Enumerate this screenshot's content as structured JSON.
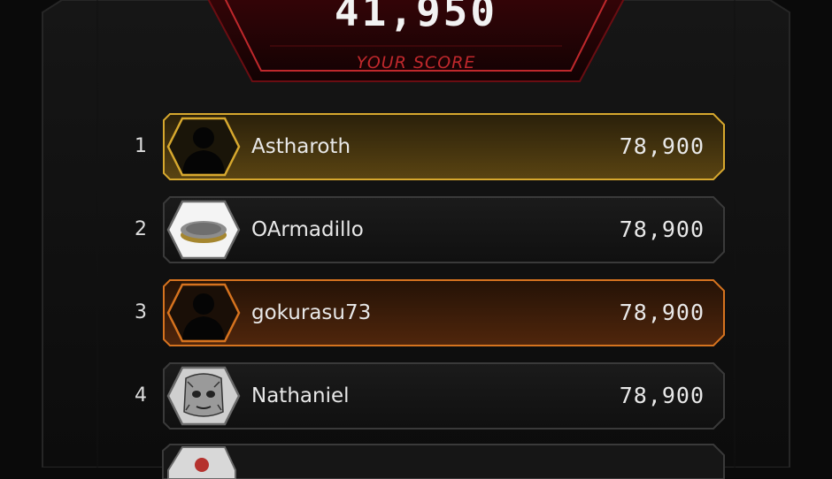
{
  "score": {
    "value": "41,950",
    "label": "YOUR SCORE"
  },
  "leaderboard": [
    {
      "rank": "1",
      "name": "Astharoth",
      "points": "78,900",
      "avatar": "silhouette-avatar-icon",
      "border": "#d7a82e"
    },
    {
      "rank": "2",
      "name": "OArmadillo",
      "points": "78,900",
      "avatar": "coin-avatar-icon",
      "border": "#3a3a3a"
    },
    {
      "rank": "3",
      "name": "gokurasu73",
      "points": "78,900",
      "avatar": "silhouette-avatar-icon",
      "border": "#d6731f"
    },
    {
      "rank": "4",
      "name": "Nathaniel",
      "points": "78,900",
      "avatar": "drawn-face-avatar-icon",
      "border": "#3a3a3a"
    }
  ],
  "colors": {
    "accent_red": "#c0282c",
    "gold": "#d7a82e",
    "bronze": "#d6731f",
    "panel": "#141414"
  }
}
